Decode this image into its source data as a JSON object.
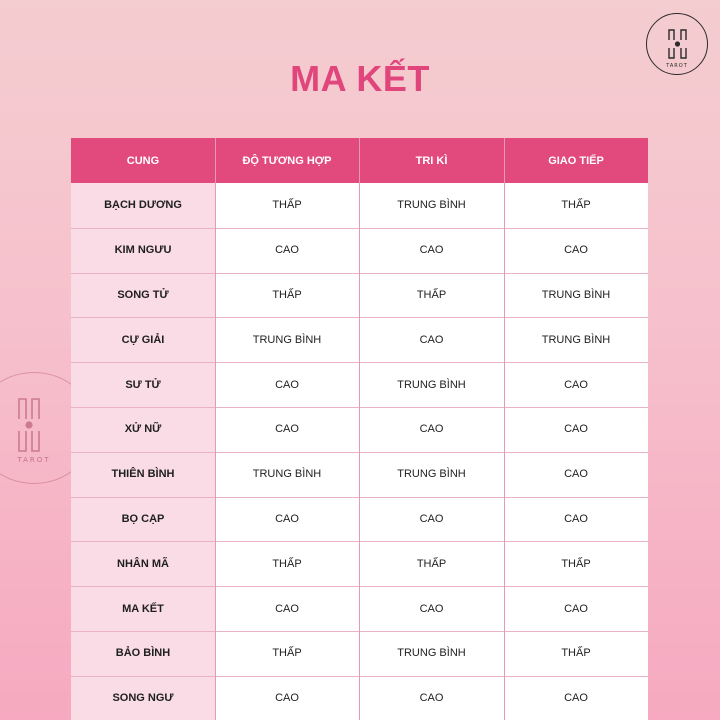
{
  "title": "MA KẾT",
  "logo": {
    "tag": "TAROT"
  },
  "table": {
    "headers": [
      "CUNG",
      "ĐỘ TƯƠNG HỢP",
      "TRI KÌ",
      "GIAO TIẾP"
    ],
    "rows": [
      [
        "BẠCH DƯƠNG",
        "THẤP",
        "TRUNG BÌNH",
        "THẤP"
      ],
      [
        "KIM NGƯU",
        "CAO",
        "CAO",
        "CAO"
      ],
      [
        "SONG TỬ",
        "THẤP",
        "THẤP",
        "TRUNG BÌNH"
      ],
      [
        "CỰ GIẢI",
        "TRUNG BÌNH",
        "CAO",
        "TRUNG BÌNH"
      ],
      [
        "SƯ TỬ",
        "CAO",
        "TRUNG BÌNH",
        "CAO"
      ],
      [
        "XỬ NỮ",
        "CAO",
        "CAO",
        "CAO"
      ],
      [
        "THIÊN BÌNH",
        "TRUNG BÌNH",
        "TRUNG BÌNH",
        "CAO"
      ],
      [
        "BỌ CẠP",
        "CAO",
        "CAO",
        "CAO"
      ],
      [
        "NHÂN MÃ",
        "THẤP",
        "THẤP",
        "THẤP"
      ],
      [
        "MA KẾT",
        "CAO",
        "CAO",
        "CAO"
      ],
      [
        "BẢO BÌNH",
        "THẤP",
        "TRUNG BÌNH",
        "THẤP"
      ],
      [
        "SONG NGƯ",
        "CAO",
        "CAO",
        "CAO"
      ]
    ]
  },
  "colors": {
    "accent": "#e2497d",
    "title": "#e0457b",
    "first_column_bg": "#f9dce6"
  }
}
